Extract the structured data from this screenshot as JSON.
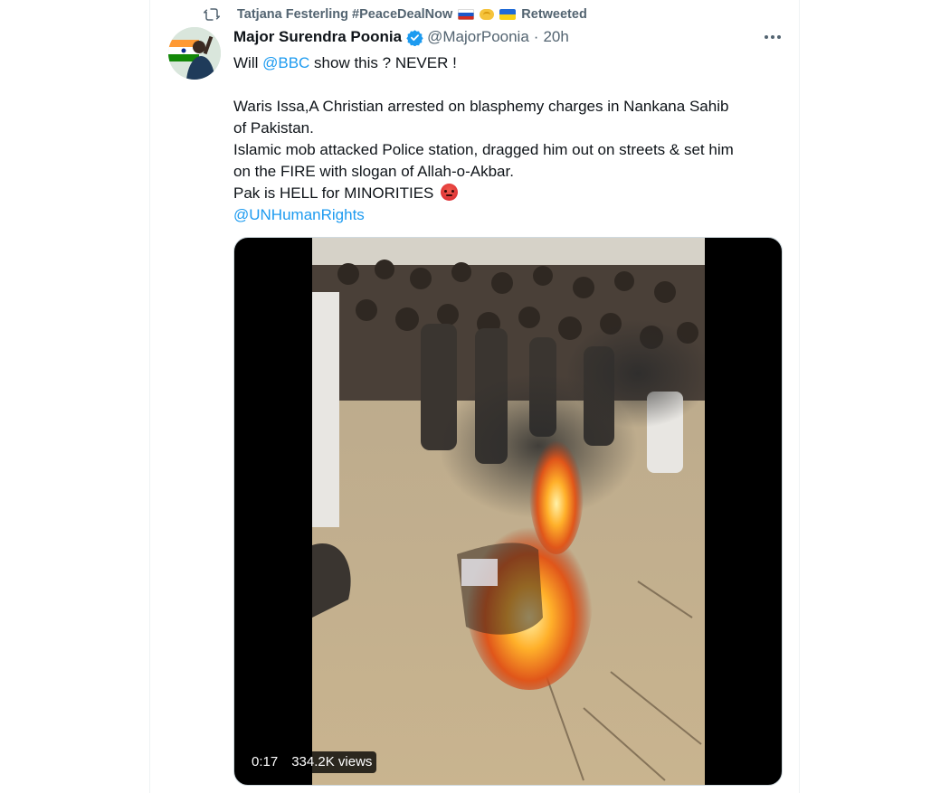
{
  "social_context": {
    "text": "Tatjana Festerling #PeaceDealNow",
    "suffix": "Retweeted",
    "icons": [
      "retweet-icon",
      "flag-russia-emoji",
      "handshake-emoji",
      "flag-ukraine-emoji"
    ]
  },
  "tweet": {
    "author_name": "Major Surendra Poonia",
    "handle": "@MajorPoonia",
    "separator": "·",
    "time": "20h",
    "verified_color": "#1d9bf0",
    "line1_prefix": "Will ",
    "line1_mention": "@BBC",
    "line1_suffix": " show this ? NEVER !",
    "para2_line1": "Waris Issa,A Christian arrested on blasphemy charges in Nankana Sahib",
    "para2_line2": "of Pakistan.",
    "para2_line3": "Islamic mob attacked Police station, dragged him out on streets & set him",
    "para2_line4": "on the FIRE with slogan of Allah-o-Akbar.",
    "para2_line5": "Pak is HELL for MINORITIES",
    "line_last_mention": "@UNHumanRights",
    "emoji": "angry-face-emoji"
  },
  "video": {
    "duration": "0:17",
    "views": "334.2K views"
  },
  "colors": {
    "link": "#1d9bf0",
    "secondary_text": "#536471",
    "primary_text": "#0f1419"
  }
}
